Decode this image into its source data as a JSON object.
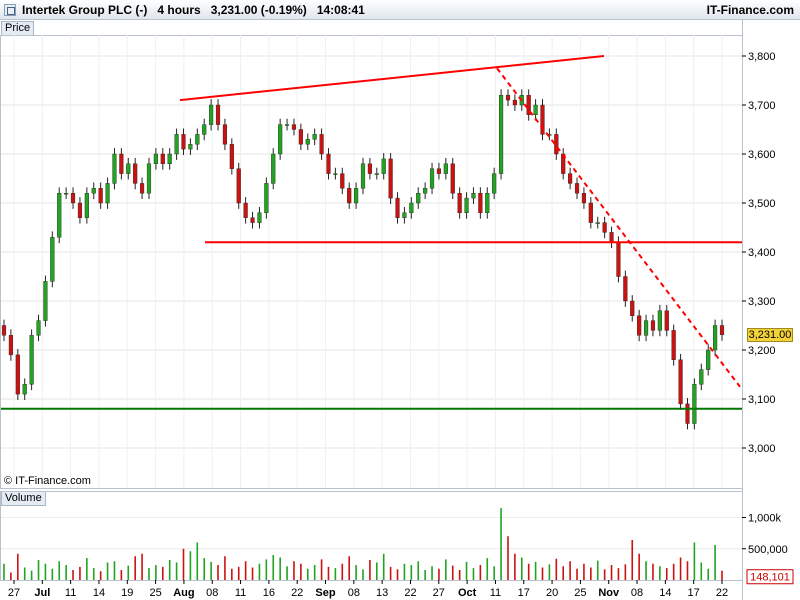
{
  "header": {
    "symbol": "Intertek Group PLC (-)",
    "interval": "4 hours",
    "last": "3,231.00",
    "change": "(-0.19%)",
    "time": "14:08:41",
    "brand": "IT-Finance.com"
  },
  "panels": {
    "price_label": "Price",
    "volume_label": "Volume",
    "copyright": "© IT-Finance.com"
  },
  "colors": {
    "up": "#22a322",
    "down": "#cc1111",
    "trendline": "#ff0000",
    "support": "#007700",
    "price_tag": "#f4d23a"
  },
  "chart_data": [
    {
      "type": "candlestick",
      "title": "Intertek Group PLC (-)",
      "ylabel": "Price",
      "ylim": [
        2960,
        3860
      ],
      "yticks": [
        "3,000",
        "3,100",
        "3,200",
        "3,300",
        "3,400",
        "3,500",
        "3,600",
        "3,700",
        "3,800"
      ],
      "ytick_values": [
        3000,
        3100,
        3200,
        3300,
        3400,
        3500,
        3600,
        3700,
        3800
      ],
      "x_tick_labels": [
        "27",
        "Jul",
        "11",
        "14",
        "19",
        "25",
        "Aug",
        "08",
        "11",
        "16",
        "22",
        "Sep",
        "08",
        "13",
        "22",
        "27",
        "Oct",
        "11",
        "17",
        "20",
        "25",
        "Nov",
        "08",
        "14",
        "17",
        "22"
      ],
      "last_price_label": "3,231.00",
      "last_price": 3231,
      "close_series_approx": [
        3230,
        3190,
        3110,
        3130,
        3230,
        3260,
        3340,
        3430,
        3520,
        3520,
        3500,
        3470,
        3520,
        3530,
        3500,
        3540,
        3600,
        3560,
        3580,
        3540,
        3520,
        3580,
        3600,
        3580,
        3600,
        3640,
        3610,
        3620,
        3640,
        3660,
        3700,
        3660,
        3620,
        3570,
        3500,
        3470,
        3460,
        3480,
        3540,
        3600,
        3660,
        3660,
        3650,
        3620,
        3630,
        3640,
        3600,
        3560,
        3560,
        3530,
        3500,
        3530,
        3580,
        3560,
        3560,
        3590,
        3510,
        3470,
        3480,
        3500,
        3520,
        3530,
        3570,
        3560,
        3580,
        3520,
        3480,
        3510,
        3520,
        3480,
        3520,
        3560,
        3720,
        3710,
        3700,
        3720,
        3680,
        3700,
        3640,
        3640,
        3600,
        3560,
        3540,
        3520,
        3500,
        3460,
        3460,
        3440,
        3420,
        3350,
        3300,
        3270,
        3230,
        3260,
        3240,
        3280,
        3240,
        3180,
        3090,
        3050,
        3130,
        3160,
        3200,
        3250,
        3231
      ],
      "annotations": [
        {
          "type": "line",
          "label": "upper trendline",
          "from": [
            "Jul 28",
            3710
          ],
          "to": [
            "Oct 28",
            3800
          ],
          "color": "#ff0000",
          "style": "solid"
        },
        {
          "type": "line",
          "label": "resistance / neckline",
          "value": 3420,
          "color": "#ff0000",
          "style": "solid"
        },
        {
          "type": "line",
          "label": "descending trendline",
          "from": [
            "Oct 03",
            3775
          ],
          "to": [
            "Nov 23",
            3125
          ],
          "color": "#ff0000",
          "style": "dashed"
        },
        {
          "type": "hline",
          "label": "support",
          "value": 3080,
          "color": "#007700",
          "style": "solid"
        }
      ]
    },
    {
      "type": "bar",
      "title": "Volume",
      "yticks": [
        "500,000",
        "1,000k"
      ],
      "ytick_values": [
        500000,
        1000000
      ],
      "ylim": [
        0,
        1200000
      ],
      "last_volume_label": "148,101",
      "volume_series_approx": [
        260000,
        120000,
        420000,
        200000,
        150000,
        320000,
        260000,
        180000,
        300000,
        240000,
        160000,
        210000,
        350000,
        190000,
        140000,
        280000,
        300000,
        160000,
        230000,
        380000,
        420000,
        190000,
        240000,
        210000,
        320000,
        280000,
        500000,
        460000,
        600000,
        350000,
        290000,
        240000,
        380000,
        180000,
        210000,
        300000,
        200000,
        260000,
        330000,
        400000,
        360000,
        220000,
        300000,
        260000,
        180000,
        240000,
        330000,
        210000,
        190000,
        260000,
        380000,
        240000,
        170000,
        320000,
        280000,
        420000,
        210000,
        170000,
        260000,
        240000,
        300000,
        160000,
        220000,
        180000,
        330000,
        230000,
        160000,
        290000,
        190000,
        240000,
        350000,
        220000,
        1150000,
        700000,
        420000,
        360000,
        260000,
        290000,
        200000,
        250000,
        340000,
        220000,
        300000,
        180000,
        260000,
        200000,
        310000,
        170000,
        240000,
        190000,
        250000,
        640000,
        420000,
        300000,
        260000,
        220000,
        190000,
        260000,
        360000,
        300000,
        600000,
        280000,
        180000,
        560000,
        148101
      ]
    }
  ]
}
